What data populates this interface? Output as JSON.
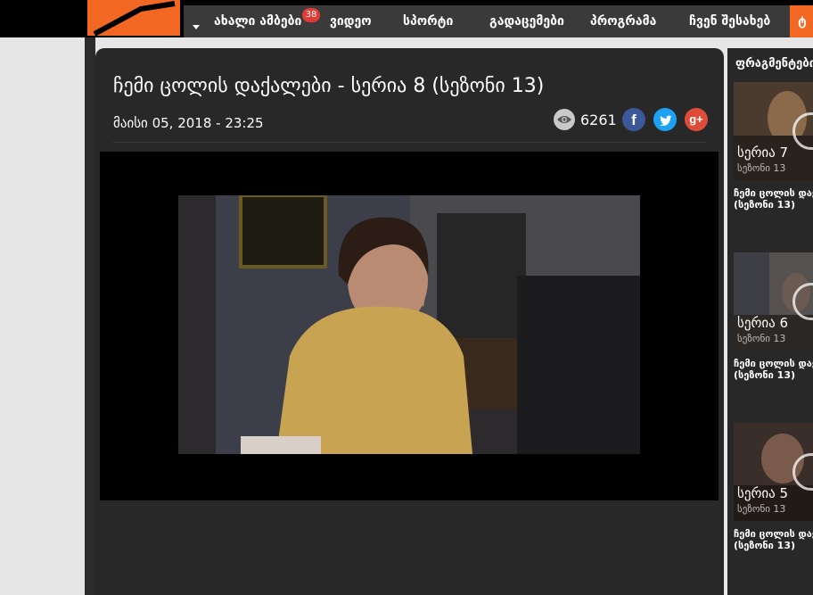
{
  "nav": {
    "items": [
      "ახალი ამბები",
      "ვიდეო",
      "სპორტი",
      "გადაცემები",
      "პროგრამა",
      "ჩვენ შესახებ"
    ],
    "badge": "38",
    "extra": "ტ"
  },
  "video": {
    "title": "ჩემი ცოლის დაქალები - სერია 8 (სეზონი 13)",
    "date": "მაისი 05, 2018 - 23:25",
    "views": "6261"
  },
  "sidebar": {
    "header": "ფრაგმენტები",
    "items": [
      {
        "episode": "სერია 7",
        "season": "სეზონი 13",
        "title_line1": "ჩემი ცოლის დაქ",
        "title_line2": "(სეზონი 13)"
      },
      {
        "episode": "სერია 6",
        "season": "სეზონი 13",
        "title_line1": "ჩემი ცოლის დაქ",
        "title_line2": "(სეზონი 13)"
      },
      {
        "episode": "სერია 5",
        "season": "სეზონი 13",
        "title_line1": "ჩემი ცოლის დაქ",
        "title_line2": "(სეზონი 13)"
      }
    ]
  },
  "colors": {
    "accent": "#f26722",
    "background": "#282828"
  }
}
